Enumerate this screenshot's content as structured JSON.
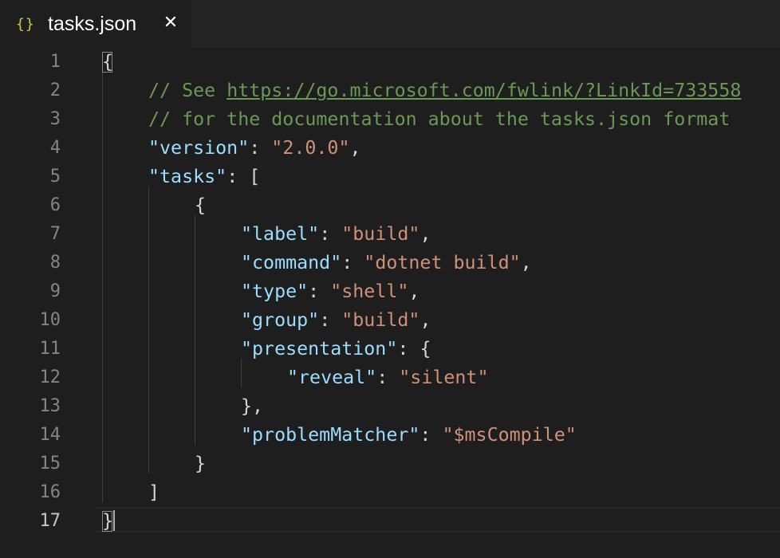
{
  "tab": {
    "icon": "{}",
    "icon_name": "json-braces-icon",
    "title": "tasks.json",
    "close": "✕"
  },
  "editor": {
    "active_line": 17,
    "line_numbers": [
      "1",
      "2",
      "3",
      "4",
      "5",
      "6",
      "7",
      "8",
      "9",
      "10",
      "11",
      "12",
      "13",
      "14",
      "15",
      "16",
      "17"
    ],
    "lines": {
      "l1": {
        "open_brace": "{"
      },
      "l2": {
        "comment_prefix": "// See ",
        "link": "https://go.microsoft.com/fwlink/?LinkId=733558"
      },
      "l3": {
        "comment": "// for the documentation about the tasks.json format"
      },
      "l4": {
        "key": "\"version\"",
        "sep": ": ",
        "value": "\"2.0.0\"",
        "end": ","
      },
      "l5": {
        "key": "\"tasks\"",
        "sep": ": ",
        "end": "["
      },
      "l6": {
        "text": "{"
      },
      "l7": {
        "key": "\"label\"",
        "sep": ": ",
        "value": "\"build\"",
        "end": ","
      },
      "l8": {
        "key": "\"command\"",
        "sep": ": ",
        "value": "\"dotnet build\"",
        "end": ","
      },
      "l9": {
        "key": "\"type\"",
        "sep": ": ",
        "value": "\"shell\"",
        "end": ","
      },
      "l10": {
        "key": "\"group\"",
        "sep": ": ",
        "value": "\"build\"",
        "end": ","
      },
      "l11": {
        "key": "\"presentation\"",
        "sep": ": ",
        "end": "{"
      },
      "l12": {
        "key": "\"reveal\"",
        "sep": ": ",
        "value": "\"silent\""
      },
      "l13": {
        "text": "},"
      },
      "l14": {
        "key": "\"problemMatcher\"",
        "sep": ": ",
        "value": "\"$msCompile\""
      },
      "l15": {
        "text": "}"
      },
      "l16": {
        "text": "]"
      },
      "l17": {
        "close_brace": "}"
      }
    }
  },
  "colors": {
    "background": "#1e1e1e",
    "tab_bar": "#252526",
    "comment": "#6a9955",
    "key": "#9cdcfe",
    "string": "#ce9178",
    "punctuation": "#d4d4d4",
    "line_number": "#858585",
    "icon": "#cbcb41"
  }
}
